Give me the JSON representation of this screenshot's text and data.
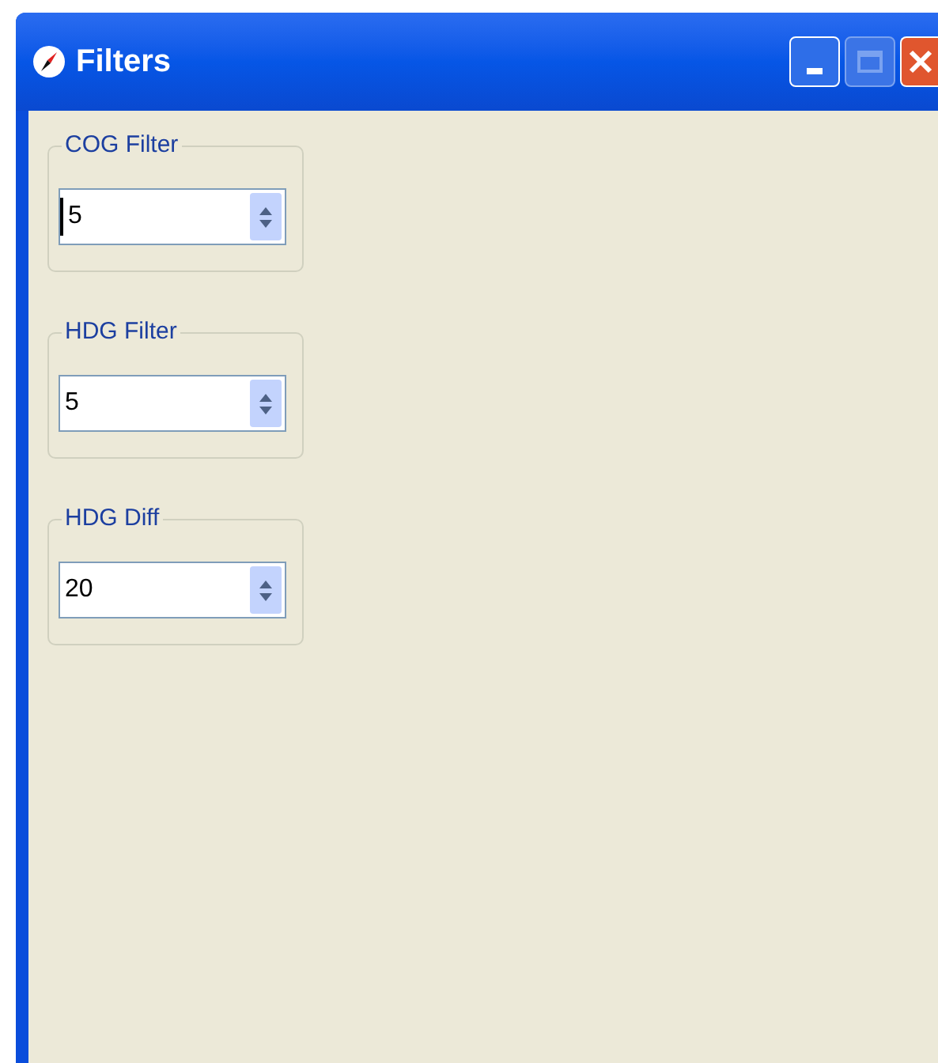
{
  "window": {
    "title": "Filters"
  },
  "groups": [
    {
      "label": "COG Filter",
      "value": "5",
      "focused": true
    },
    {
      "label": "HDG Filter",
      "value": "5",
      "focused": false
    },
    {
      "label": "HDG Diff",
      "value": "20",
      "focused": false
    }
  ]
}
